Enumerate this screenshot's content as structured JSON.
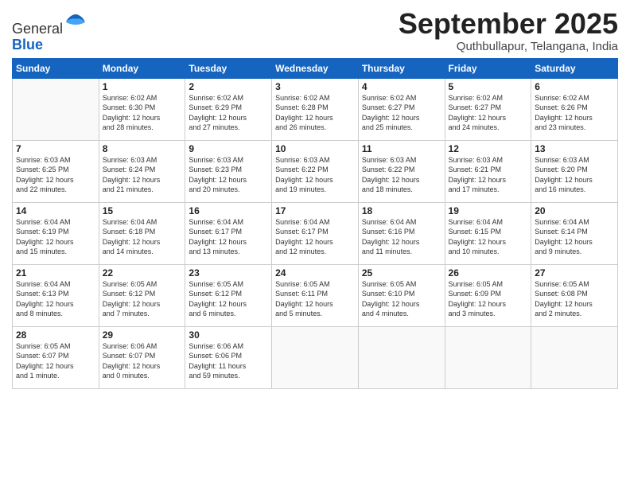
{
  "logo": {
    "general": "General",
    "blue": "Blue"
  },
  "title": "September 2025",
  "subtitle": "Quthbullapur, Telangana, India",
  "days_of_week": [
    "Sunday",
    "Monday",
    "Tuesday",
    "Wednesday",
    "Thursday",
    "Friday",
    "Saturday"
  ],
  "weeks": [
    [
      {
        "day": "",
        "info": ""
      },
      {
        "day": "1",
        "info": "Sunrise: 6:02 AM\nSunset: 6:30 PM\nDaylight: 12 hours\nand 28 minutes."
      },
      {
        "day": "2",
        "info": "Sunrise: 6:02 AM\nSunset: 6:29 PM\nDaylight: 12 hours\nand 27 minutes."
      },
      {
        "day": "3",
        "info": "Sunrise: 6:02 AM\nSunset: 6:28 PM\nDaylight: 12 hours\nand 26 minutes."
      },
      {
        "day": "4",
        "info": "Sunrise: 6:02 AM\nSunset: 6:27 PM\nDaylight: 12 hours\nand 25 minutes."
      },
      {
        "day": "5",
        "info": "Sunrise: 6:02 AM\nSunset: 6:27 PM\nDaylight: 12 hours\nand 24 minutes."
      },
      {
        "day": "6",
        "info": "Sunrise: 6:02 AM\nSunset: 6:26 PM\nDaylight: 12 hours\nand 23 minutes."
      }
    ],
    [
      {
        "day": "7",
        "info": "Sunrise: 6:03 AM\nSunset: 6:25 PM\nDaylight: 12 hours\nand 22 minutes."
      },
      {
        "day": "8",
        "info": "Sunrise: 6:03 AM\nSunset: 6:24 PM\nDaylight: 12 hours\nand 21 minutes."
      },
      {
        "day": "9",
        "info": "Sunrise: 6:03 AM\nSunset: 6:23 PM\nDaylight: 12 hours\nand 20 minutes."
      },
      {
        "day": "10",
        "info": "Sunrise: 6:03 AM\nSunset: 6:22 PM\nDaylight: 12 hours\nand 19 minutes."
      },
      {
        "day": "11",
        "info": "Sunrise: 6:03 AM\nSunset: 6:22 PM\nDaylight: 12 hours\nand 18 minutes."
      },
      {
        "day": "12",
        "info": "Sunrise: 6:03 AM\nSunset: 6:21 PM\nDaylight: 12 hours\nand 17 minutes."
      },
      {
        "day": "13",
        "info": "Sunrise: 6:03 AM\nSunset: 6:20 PM\nDaylight: 12 hours\nand 16 minutes."
      }
    ],
    [
      {
        "day": "14",
        "info": "Sunrise: 6:04 AM\nSunset: 6:19 PM\nDaylight: 12 hours\nand 15 minutes."
      },
      {
        "day": "15",
        "info": "Sunrise: 6:04 AM\nSunset: 6:18 PM\nDaylight: 12 hours\nand 14 minutes."
      },
      {
        "day": "16",
        "info": "Sunrise: 6:04 AM\nSunset: 6:17 PM\nDaylight: 12 hours\nand 13 minutes."
      },
      {
        "day": "17",
        "info": "Sunrise: 6:04 AM\nSunset: 6:17 PM\nDaylight: 12 hours\nand 12 minutes."
      },
      {
        "day": "18",
        "info": "Sunrise: 6:04 AM\nSunset: 6:16 PM\nDaylight: 12 hours\nand 11 minutes."
      },
      {
        "day": "19",
        "info": "Sunrise: 6:04 AM\nSunset: 6:15 PM\nDaylight: 12 hours\nand 10 minutes."
      },
      {
        "day": "20",
        "info": "Sunrise: 6:04 AM\nSunset: 6:14 PM\nDaylight: 12 hours\nand 9 minutes."
      }
    ],
    [
      {
        "day": "21",
        "info": "Sunrise: 6:04 AM\nSunset: 6:13 PM\nDaylight: 12 hours\nand 8 minutes."
      },
      {
        "day": "22",
        "info": "Sunrise: 6:05 AM\nSunset: 6:12 PM\nDaylight: 12 hours\nand 7 minutes."
      },
      {
        "day": "23",
        "info": "Sunrise: 6:05 AM\nSunset: 6:12 PM\nDaylight: 12 hours\nand 6 minutes."
      },
      {
        "day": "24",
        "info": "Sunrise: 6:05 AM\nSunset: 6:11 PM\nDaylight: 12 hours\nand 5 minutes."
      },
      {
        "day": "25",
        "info": "Sunrise: 6:05 AM\nSunset: 6:10 PM\nDaylight: 12 hours\nand 4 minutes."
      },
      {
        "day": "26",
        "info": "Sunrise: 6:05 AM\nSunset: 6:09 PM\nDaylight: 12 hours\nand 3 minutes."
      },
      {
        "day": "27",
        "info": "Sunrise: 6:05 AM\nSunset: 6:08 PM\nDaylight: 12 hours\nand 2 minutes."
      }
    ],
    [
      {
        "day": "28",
        "info": "Sunrise: 6:05 AM\nSunset: 6:07 PM\nDaylight: 12 hours\nand 1 minute."
      },
      {
        "day": "29",
        "info": "Sunrise: 6:06 AM\nSunset: 6:07 PM\nDaylight: 12 hours\nand 0 minutes."
      },
      {
        "day": "30",
        "info": "Sunrise: 6:06 AM\nSunset: 6:06 PM\nDaylight: 11 hours\nand 59 minutes."
      },
      {
        "day": "",
        "info": ""
      },
      {
        "day": "",
        "info": ""
      },
      {
        "day": "",
        "info": ""
      },
      {
        "day": "",
        "info": ""
      }
    ]
  ]
}
